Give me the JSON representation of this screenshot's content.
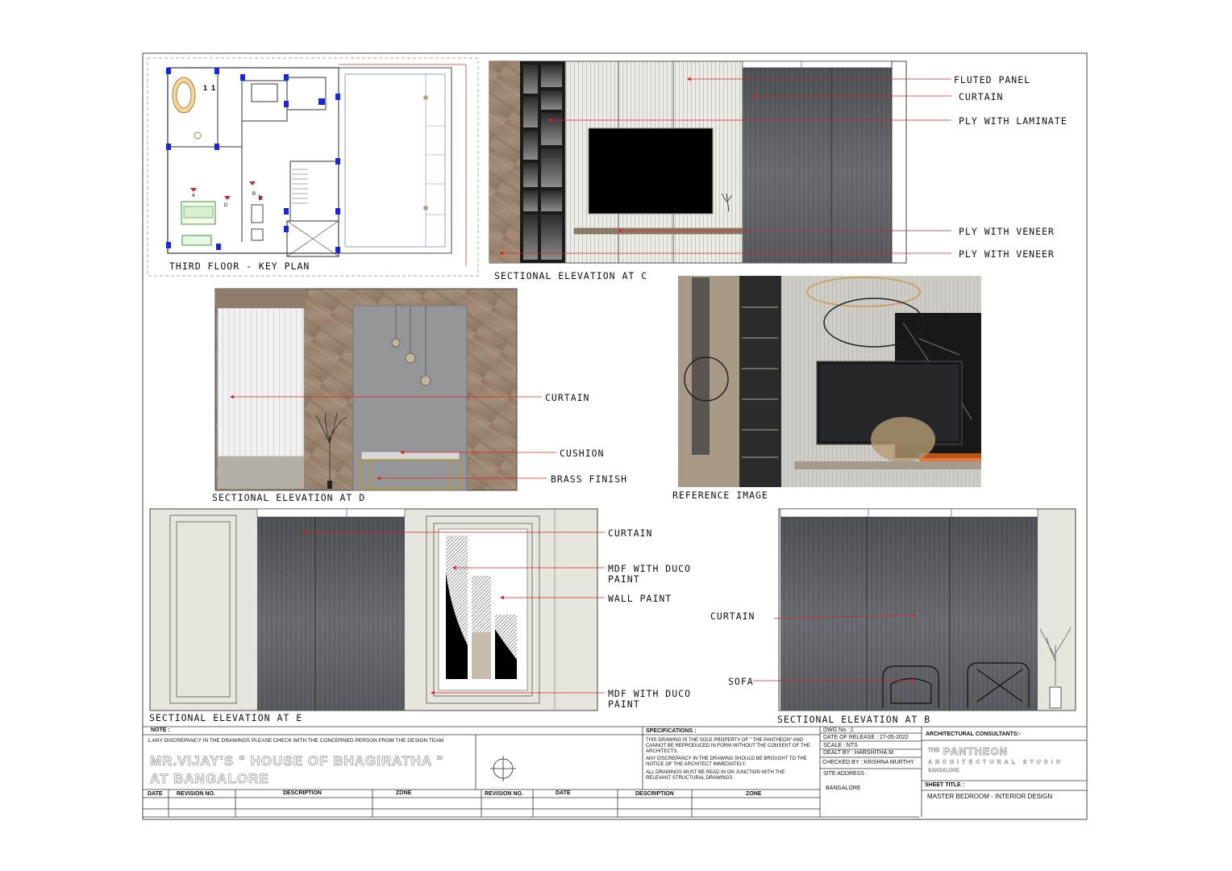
{
  "key_plan": {
    "caption": "THIRD FLOOR - KEY PLAN"
  },
  "elevation_c": {
    "caption": "SECTIONAL ELEVATION AT C",
    "labels": [
      "FLUTED PANEL",
      "CURTAIN",
      "PLY WITH LAMINATE",
      "PLY WITH VENEER",
      "PLY WITH VENEER"
    ]
  },
  "elevation_d": {
    "caption": "SECTIONAL ELEVATION AT D",
    "labels": [
      "CURTAIN",
      "CUSHION",
      "BRASS FINISH"
    ]
  },
  "reference": {
    "caption": "REFERENCE IMAGE"
  },
  "elevation_e": {
    "caption": "SECTIONAL ELEVATION AT E",
    "labels": [
      "CURTAIN",
      "MDF WITH DUCO",
      "PAINT",
      "WALL PAINT",
      "MDF WITH DUCO",
      "PAINT"
    ]
  },
  "elevation_b": {
    "caption": "SECTIONAL ELEVATION AT B",
    "labels": [
      "CURTAIN",
      "SOFA"
    ]
  },
  "title_block": {
    "note_heading": "NOTE :",
    "note_text": "1.ANY DISCREPANCY IN THE DRAWINGS PLEASE CHECK WITH THE CONCERNED PERSON FROM THE DESIGN TEAM.",
    "project_line1": "MR.VIJAY'S \" HOUSE OF BHAGIRATHA \"",
    "project_line2": "AT BANGALORE",
    "revision_headers": [
      "DATE",
      "REVISION NO.",
      "DESCRIPTION",
      "ZONE",
      "REVISION NO.",
      "DATE",
      "DESCRIPTION",
      "ZONE"
    ],
    "specifications_heading": "SPECIFICATIONS :",
    "spec_1": "THIS DRAWING IS THE SOLE PROPERTY OF \" THE PANTHEON\" AND CANNOT BE REPRODUCED IN FORM WITHOUT THE CONSENT OF THE ARCHITECTS.",
    "spec_2": "ANY DISCREPANCY IN THE DRAWING SHOULD BE BROUGHT TO THE NOTICE OF THE  ARCHITECT IMMEDIATELY.",
    "spec_3": "ALL DRAWINGS MUST BE READ IN ON JUNCTION WITH THE RELEVANT STRUCTURAL DRAWINGS.",
    "dwg_no": "DWG No. :1",
    "date_of_release": "DATE OF RELEASE : 27-05-2022",
    "scale": "SCALE : NTS",
    "dealt_by": "DEALT BY : HARSHITHA.M",
    "checked_by": "CHECKED BY : KRISHNA MURTHY",
    "site_address_label": "SITE ADDRESS :",
    "site_address": "BANGALORE",
    "consultants_heading": "ARCHITECTURAL CONSULTANTS:-",
    "firm_prefix": "THE",
    "firm_name": "PANTHEON",
    "firm_subtitle": "ARCHITECTURAL STUDIO",
    "firm_city": "BANGALORE",
    "sheet_title_label": "SHEET TITLE :",
    "sheet_title": "MASTER BEDROOM - INTERIOR DESIGN"
  },
  "colors": {
    "callout": "#e02020",
    "curtain": "#55585c",
    "wood": "#9a8470",
    "panel": "#e8e8e2"
  }
}
